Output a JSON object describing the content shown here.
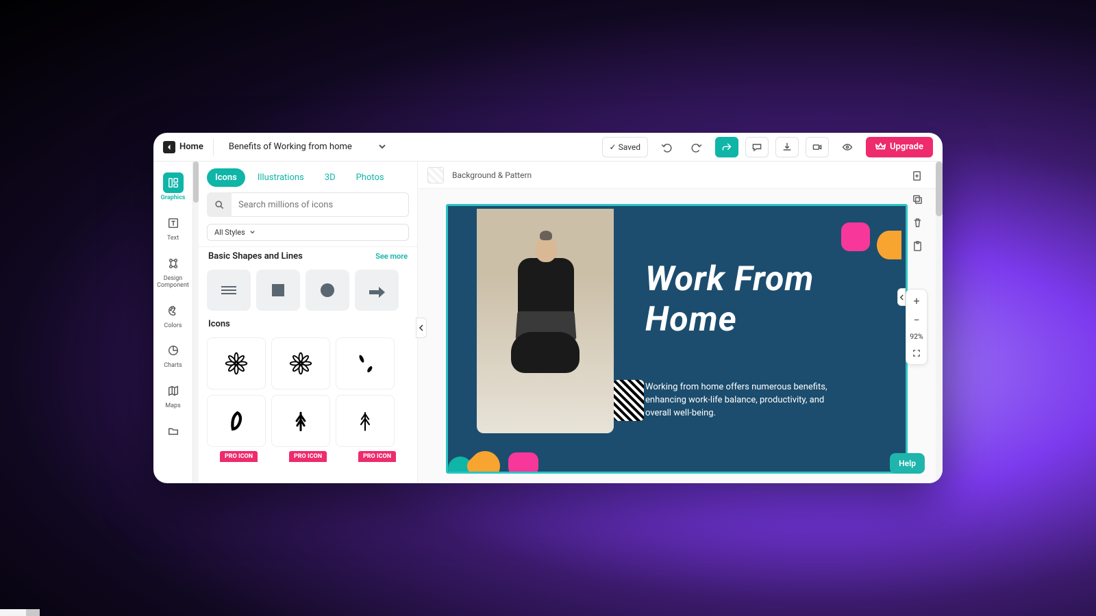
{
  "topbar": {
    "home": "Home",
    "doc_title": "Benefits of Working from home",
    "saved": "✓ Saved",
    "upgrade": "Upgrade"
  },
  "rail": {
    "graphics": "Graphics",
    "text": "Text",
    "dc1": "Design",
    "dc2": "Component",
    "colors": "Colors",
    "charts": "Charts",
    "maps": "Maps"
  },
  "panel": {
    "tabs": {
      "icons": "Icons",
      "illustrations": "Illustrations",
      "threeD": "3D",
      "photos": "Photos"
    },
    "search_placeholder": "Search millions of icons",
    "all_styles": "All Styles",
    "shapes_title": "Basic Shapes and Lines",
    "see_more": "See more",
    "icons_title": "Icons",
    "pro": "PRO ICON"
  },
  "canvas": {
    "bg_pattern": "Background & Pattern",
    "slide_title_l1": "Work From",
    "slide_title_l2": "Home",
    "slide_body": "Working from home offers numerous benefits, enhancing work-life balance, productivity, and overall well-being."
  },
  "zoom": {
    "value": "92%"
  },
  "help": "Help"
}
